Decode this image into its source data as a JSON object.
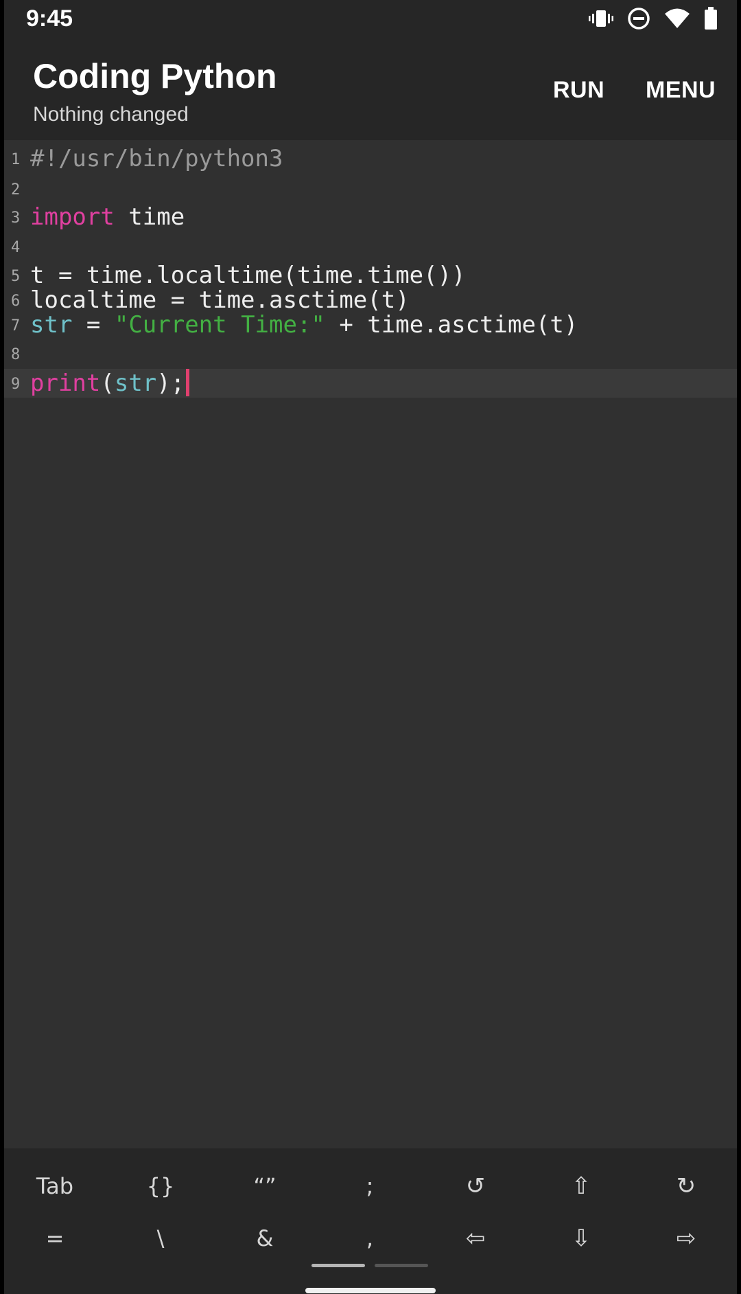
{
  "status_bar": {
    "time": "9:45",
    "icons": [
      "vibrate-icon",
      "do-not-disturb-icon",
      "wifi-icon",
      "battery-icon"
    ]
  },
  "app_bar": {
    "title": "Coding Python",
    "subtitle": "Nothing changed",
    "actions": {
      "run": "RUN",
      "menu": "MENU"
    }
  },
  "editor": {
    "current_line": 9,
    "lines": [
      {
        "number": "1",
        "tokens": [
          {
            "type": "comment",
            "text": "#!/usr/bin/python3"
          }
        ]
      },
      {
        "number": "2",
        "tokens": []
      },
      {
        "number": "3",
        "tokens": [
          {
            "type": "keyword",
            "text": "import"
          },
          {
            "type": "default",
            "text": " time"
          }
        ]
      },
      {
        "number": "4",
        "tokens": []
      },
      {
        "number": "5",
        "tokens": [
          {
            "type": "default",
            "text": "t = time.localtime(time.time())"
          }
        ]
      },
      {
        "number": "6",
        "tokens": [
          {
            "type": "default",
            "text": "localtime = time.asctime(t)"
          }
        ]
      },
      {
        "number": "7",
        "tokens": [
          {
            "type": "builtin",
            "text": "str"
          },
          {
            "type": "default",
            "text": " = "
          },
          {
            "type": "string",
            "text": "\"Current Time:\""
          },
          {
            "type": "default",
            "text": " + time.asctime(t)"
          }
        ]
      },
      {
        "number": "8",
        "tokens": []
      },
      {
        "number": "9",
        "tokens": [
          {
            "type": "keyword",
            "text": "print"
          },
          {
            "type": "default",
            "text": "("
          },
          {
            "type": "builtin",
            "text": "str"
          },
          {
            "type": "default",
            "text": ");"
          }
        ]
      }
    ]
  },
  "extra_keys": {
    "row1": [
      {
        "name": "tab-key",
        "label": "Tab"
      },
      {
        "name": "braces-key",
        "label": "{}"
      },
      {
        "name": "quotes-key",
        "label": "“”"
      },
      {
        "name": "semicolon-key",
        "label": ";"
      },
      {
        "name": "undo-key",
        "label": "↺",
        "icon": "undo-icon"
      },
      {
        "name": "arrow-up-key",
        "label": "⇧",
        "icon": "arrow-up-icon"
      },
      {
        "name": "redo-key",
        "label": "↻",
        "icon": "redo-icon"
      }
    ],
    "row2": [
      {
        "name": "equals-key",
        "label": "="
      },
      {
        "name": "backslash-key",
        "label": "\\"
      },
      {
        "name": "ampersand-key",
        "label": "&"
      },
      {
        "name": "comma-key",
        "label": ","
      },
      {
        "name": "arrow-left-key",
        "label": "⇦",
        "icon": "arrow-left-icon"
      },
      {
        "name": "arrow-down-key",
        "label": "⇩",
        "icon": "arrow-down-icon"
      },
      {
        "name": "arrow-right-key",
        "label": "⇨",
        "icon": "arrow-right-icon"
      }
    ]
  },
  "colors": {
    "background": "#303030",
    "app_bar": "#262626",
    "keyword": "#e040a0",
    "builtin": "#6fc1c9",
    "string": "#43b043",
    "comment": "#9a9a9a",
    "cursor": "#e0406e"
  }
}
